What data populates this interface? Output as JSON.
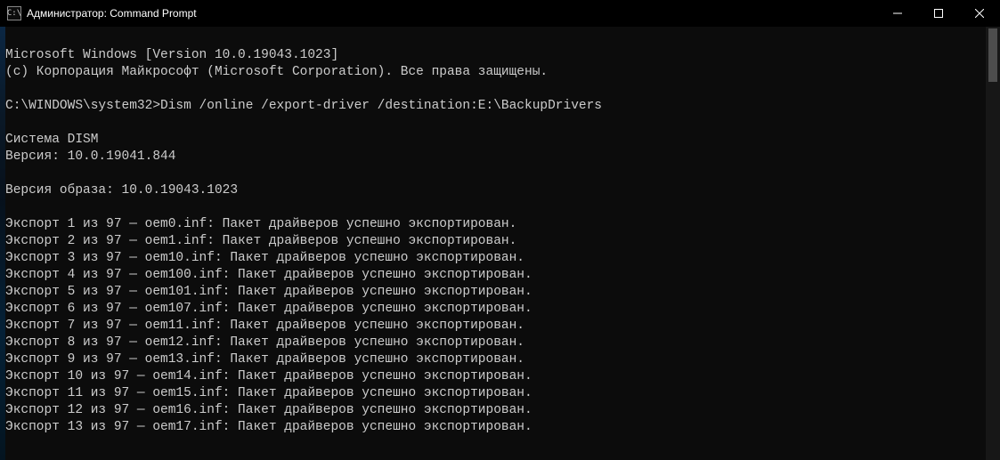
{
  "titlebar": {
    "icon_text": "C:\\",
    "title": "Администратор: Command Prompt"
  },
  "console": {
    "header_line1": "Microsoft Windows [Version 10.0.19043.1023]",
    "header_line2": "(c) Корпорация Майкрософт (Microsoft Corporation). Все права защищены.",
    "prompt": "C:\\WINDOWS\\system32>",
    "command": "Dism /online /export-driver /destination:E:\\BackupDrivers",
    "dism_system": "Система DISM",
    "dism_version": "Версия: 10.0.19041.844",
    "image_version": "Версия образа: 10.0.19043.1023",
    "exports": [
      "Экспорт 1 из 97 — oem0.inf: Пакет драйверов успешно экспортирован.",
      "Экспорт 2 из 97 — oem1.inf: Пакет драйверов успешно экспортирован.",
      "Экспорт 3 из 97 — oem10.inf: Пакет драйверов успешно экспортирован.",
      "Экспорт 4 из 97 — oem100.inf: Пакет драйверов успешно экспортирован.",
      "Экспорт 5 из 97 — oem101.inf: Пакет драйверов успешно экспортирован.",
      "Экспорт 6 из 97 — oem107.inf: Пакет драйверов успешно экспортирован.",
      "Экспорт 7 из 97 — oem11.inf: Пакет драйверов успешно экспортирован.",
      "Экспорт 8 из 97 — oem12.inf: Пакет драйверов успешно экспортирован.",
      "Экспорт 9 из 97 — oem13.inf: Пакет драйверов успешно экспортирован.",
      "Экспорт 10 из 97 — oem14.inf: Пакет драйверов успешно экспортирован.",
      "Экспорт 11 из 97 — oem15.inf: Пакет драйверов успешно экспортирован.",
      "Экспорт 12 из 97 — oem16.inf: Пакет драйверов успешно экспортирован.",
      "Экспорт 13 из 97 — oem17.inf: Пакет драйверов успешно экспортирован."
    ]
  }
}
